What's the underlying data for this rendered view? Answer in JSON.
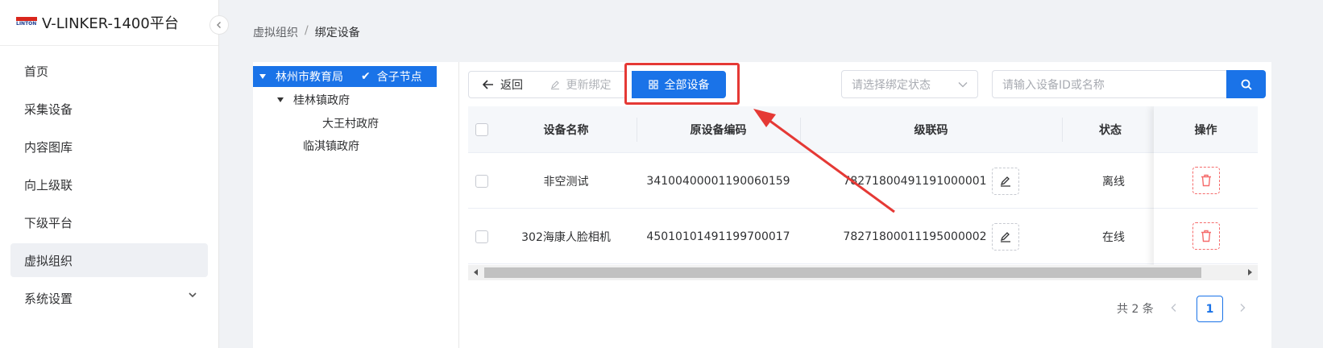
{
  "app": {
    "title": "V-LINKER-1400平台",
    "logo_text": "LINTON"
  },
  "sidebar": {
    "items": [
      {
        "label": "首页"
      },
      {
        "label": "采集设备"
      },
      {
        "label": "内容图库"
      },
      {
        "label": "向上级联"
      },
      {
        "label": "下级平台"
      },
      {
        "label": "虚拟组织",
        "active": true
      },
      {
        "label": "系统设置",
        "has_submenu": true
      }
    ]
  },
  "breadcrumb": {
    "parent": "虚拟组织",
    "separator": "/",
    "current": "绑定设备"
  },
  "tree": {
    "root": "林州市教育局",
    "include_children": "含子节点",
    "child1": "桂林镇政府",
    "grandchild1": "大王村政府",
    "child2": "临淇镇政府"
  },
  "toolbar": {
    "back_label": "返回",
    "update_label": "更新绑定",
    "all_devices_label": "全部设备",
    "bind_status_placeholder": "请选择绑定状态",
    "search_placeholder": "请输入设备ID或名称"
  },
  "table": {
    "headers": {
      "name": "设备名称",
      "original_code": "原设备编码",
      "cascade_code": "级联码",
      "status": "状态",
      "actions": "操作"
    },
    "rows": [
      {
        "name": "非空测试",
        "original_code": "34100400001190060159",
        "cascade_code": "78271800491191000001",
        "status": "离线"
      },
      {
        "name": "302海康人脸相机",
        "original_code": "45010101491199700017",
        "cascade_code": "78271800011195000002",
        "status": "在线"
      }
    ]
  },
  "pagination": {
    "total_text": "共 2 条",
    "current_page": "1"
  },
  "colors": {
    "primary": "#1a73e8",
    "danger": "#f56c6c",
    "annotation": "#e53935"
  }
}
